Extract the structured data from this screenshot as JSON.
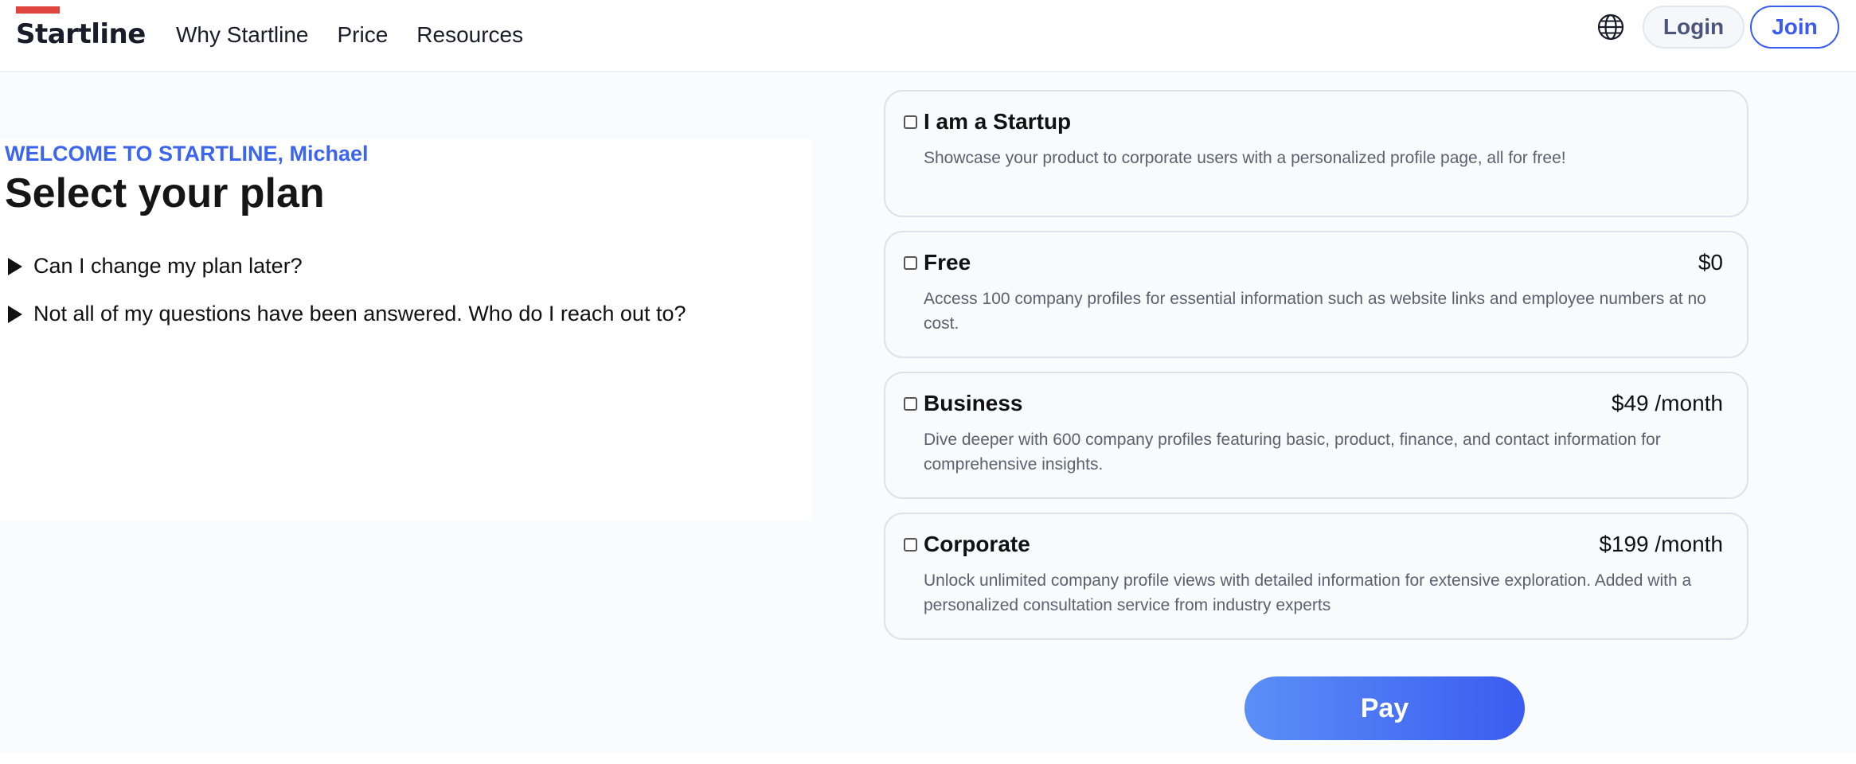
{
  "header": {
    "logo": "Startline",
    "nav": [
      "Why Startline",
      "Price",
      "Resources"
    ],
    "globe_icon": "globe-icon",
    "login_label": "Login",
    "join_label": "Join"
  },
  "intro": {
    "welcome": "WELCOME TO STARTLINE, Michael",
    "heading": "Select your plan",
    "faqs": [
      "Can I change my plan later?",
      "Not all of my questions have been answered. Who do I reach out to?"
    ]
  },
  "plans": [
    {
      "name": "I am a Startup",
      "price": "",
      "description": "Showcase your product to corporate users with a personalized profile page, all for free!",
      "checked": false
    },
    {
      "name": "Free",
      "price": "$0",
      "description": "Access 100 company profiles for essential information such as website links and employee numbers at no cost.",
      "checked": false
    },
    {
      "name": "Business",
      "price": "$49 /month",
      "description": "Dive deeper with 600 company profiles featuring basic, product, finance, and contact information for comprehensive insights.",
      "checked": false
    },
    {
      "name": "Corporate",
      "price": "$199 /month",
      "description": "Unlock unlimited company profile views with detailed information for extensive exploration. Added with a personalized consultation service from industry experts",
      "checked": false
    }
  ],
  "pay_label": "Pay",
  "colors": {
    "accent": "#3b65ee",
    "logo_bar": "#e0453d",
    "pay_gradient_start": "#5b8ff7",
    "pay_gradient_end": "#3a5cf0"
  }
}
